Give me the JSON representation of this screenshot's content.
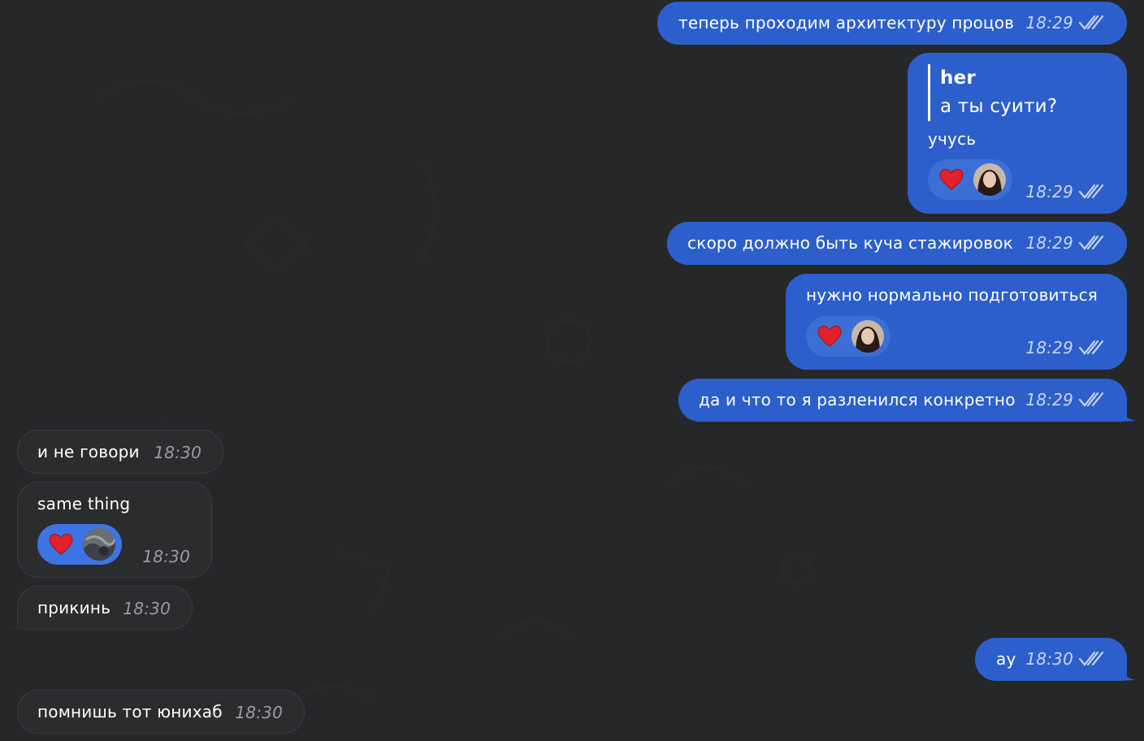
{
  "colors": {
    "background": "#252729",
    "outgoing_bubble": "#2c5fcb",
    "incoming_bubble": "#2b2c2e",
    "reaction_heart": "#e0202a"
  },
  "messages": [
    {
      "id": "m1",
      "direction": "outgoing",
      "text": "теперь проходим архитектуру процов",
      "time": "18:29",
      "status": "read-double-check-icon"
    },
    {
      "id": "m2",
      "direction": "outgoing",
      "reply_to": {
        "name": "her",
        "text": "а ты суити?"
      },
      "text": "учусь",
      "reaction": "heart-icon",
      "time": "18:29",
      "status": "read-double-check-icon"
    },
    {
      "id": "m3",
      "direction": "outgoing",
      "text": "скоро должно быть куча стажировок",
      "time": "18:29",
      "status": "read-double-check-icon"
    },
    {
      "id": "m4",
      "direction": "outgoing",
      "text": "нужно нормально подготовиться",
      "reaction": "heart-icon",
      "time": "18:29",
      "status": "read-double-check-icon"
    },
    {
      "id": "m5",
      "direction": "outgoing",
      "text": "да и что то я разленился конкретно",
      "time": "18:29",
      "status": "read-double-check-icon"
    },
    {
      "id": "m6",
      "direction": "incoming",
      "text": "и не говори",
      "time": "18:30"
    },
    {
      "id": "m7",
      "direction": "incoming",
      "text": "same thing",
      "reaction": "heart-icon",
      "time": "18:30"
    },
    {
      "id": "m8",
      "direction": "incoming",
      "text": "прикинь",
      "time": "18:30"
    },
    {
      "id": "m9",
      "direction": "outgoing",
      "text": "ау",
      "time": "18:30",
      "status": "read-double-check-icon"
    },
    {
      "id": "m10",
      "direction": "incoming",
      "text": "помнишь тот юнихаб",
      "time": "18:30"
    }
  ]
}
